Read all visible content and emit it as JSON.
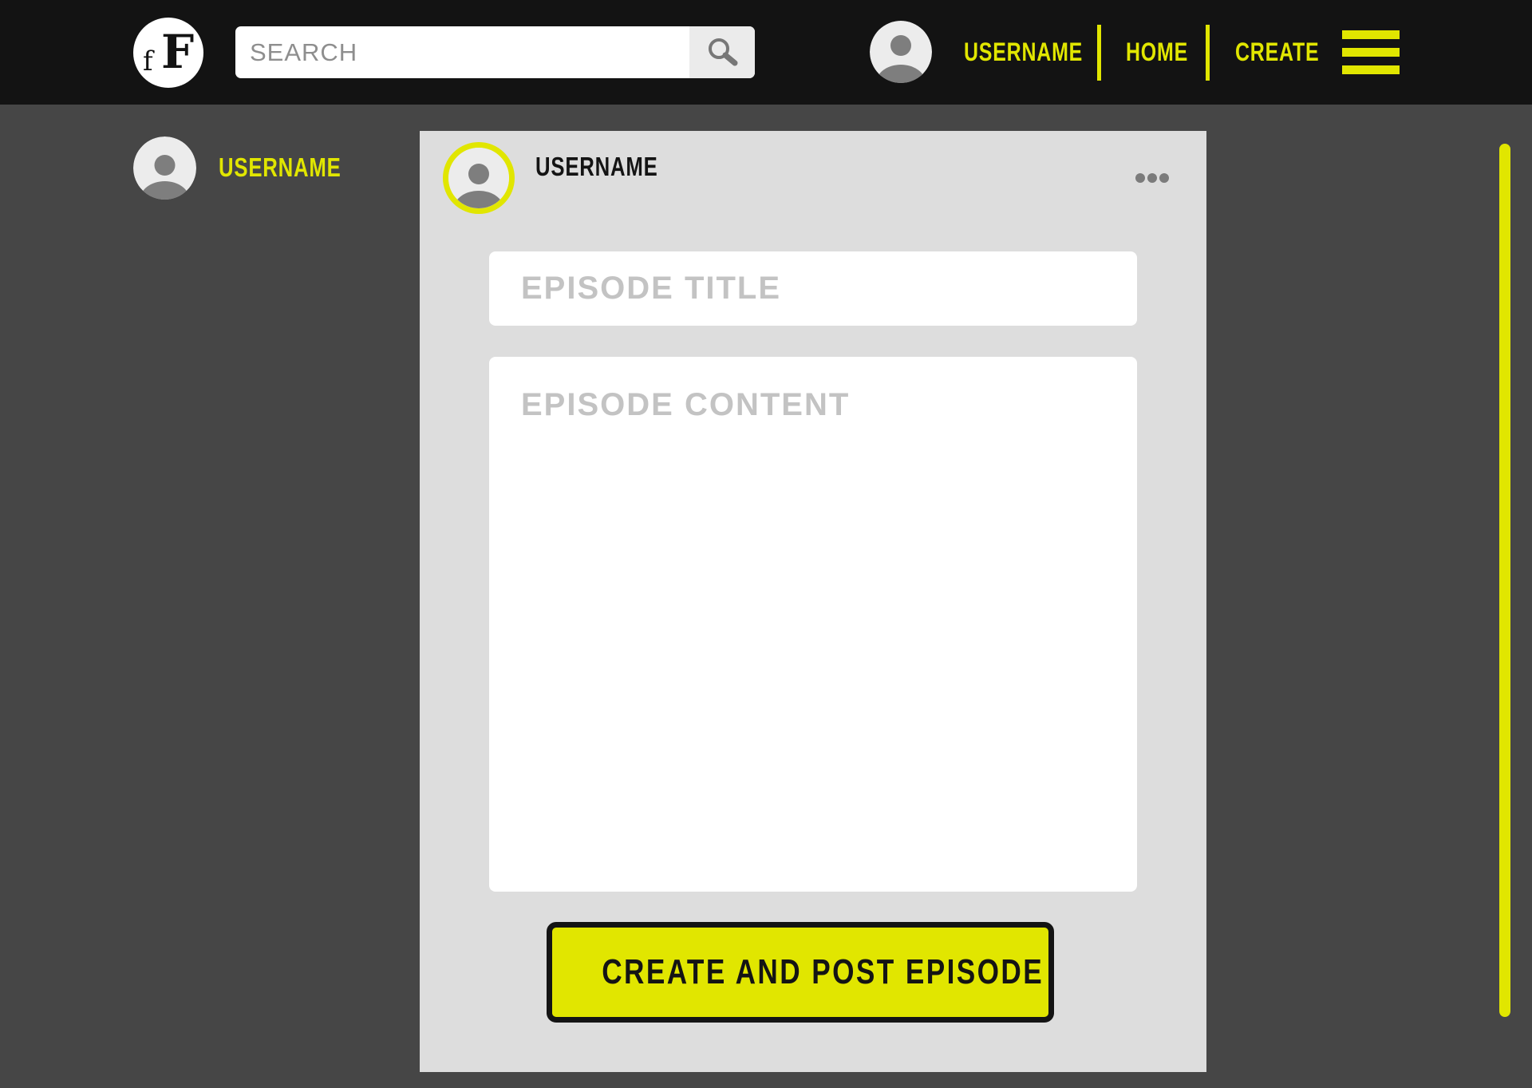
{
  "header": {
    "logo": {
      "text_small": "f",
      "text_big": "F",
      "icon": "ff-logo-icon"
    },
    "search": {
      "placeholder": "SEARCH",
      "value": "",
      "icon": "search-icon"
    },
    "nav": {
      "username": "USERNAME",
      "home": "HOME",
      "create": "CREATE",
      "menu_icon": "hamburger-menu-icon"
    }
  },
  "sidebar": {
    "username": "USERNAME"
  },
  "post_form": {
    "author": "USERNAME",
    "more_icon": "more-options-icon",
    "title_placeholder": "EPISODE TITLE",
    "title_value": "",
    "content_placeholder": "EPISODE CONTENT",
    "content_value": "",
    "submit_label": "CREATE AND POST EPISODE"
  },
  "colors": {
    "accent": "#e1e600",
    "topbar": "#131313",
    "background": "#464646",
    "card": "#dddddd"
  }
}
